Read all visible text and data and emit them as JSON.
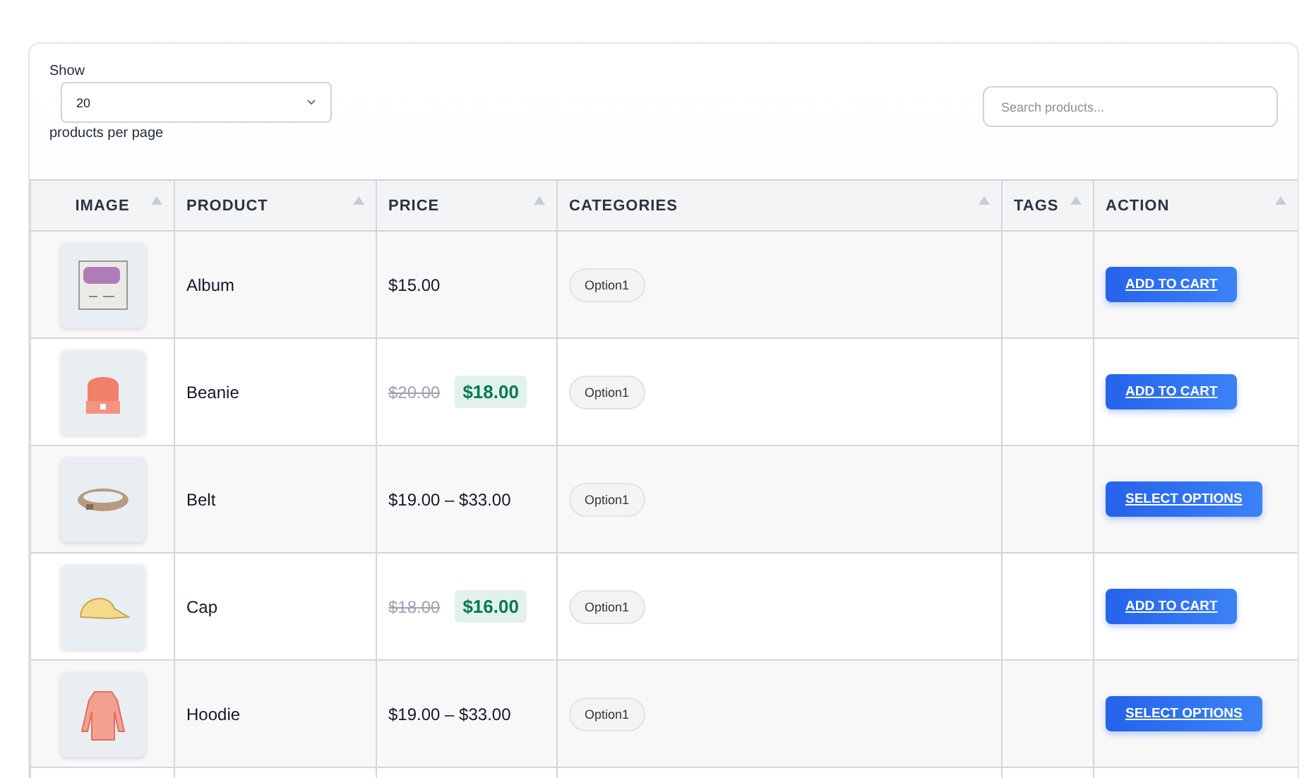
{
  "length_control": {
    "label_before": "Show",
    "value": "20",
    "label_after": "products per page"
  },
  "search": {
    "placeholder": "Search products..."
  },
  "table": {
    "columns": [
      "IMAGE",
      "PRODUCT",
      "PRICE",
      "CATEGORIES",
      "TAGS",
      "ACTION"
    ],
    "rows": [
      {
        "kind": "album",
        "product": "Album",
        "price": {
          "kind": "regular",
          "text": "$15.00"
        },
        "category": "Option1",
        "action": "ADD TO CART"
      },
      {
        "kind": "beanie",
        "product": "Beanie",
        "price": {
          "kind": "sale",
          "old": "$20.00",
          "now": "$18.00"
        },
        "category": "Option1",
        "action": "ADD TO CART"
      },
      {
        "kind": "belt",
        "product": "Belt",
        "price": {
          "kind": "regular",
          "text": "$19.00 – $33.00"
        },
        "category": "Option1",
        "action": "SELECT OPTIONS"
      },
      {
        "kind": "cap",
        "product": "Cap",
        "price": {
          "kind": "sale",
          "old": "$18.00",
          "now": "$16.00"
        },
        "category": "Option1",
        "action": "ADD TO CART"
      },
      {
        "kind": "hoodie",
        "product": "Hoodie",
        "price": {
          "kind": "regular",
          "text": "$19.00 – $33.00"
        },
        "category": "Option1",
        "action": "SELECT OPTIONS"
      }
    ]
  }
}
